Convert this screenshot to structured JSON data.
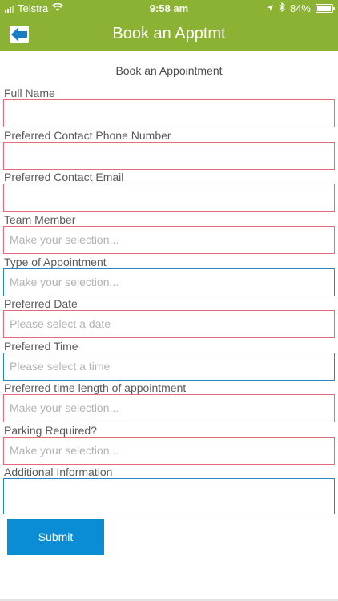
{
  "status_bar": {
    "carrier": "Telstra",
    "time": "9:58 am",
    "battery": "84%"
  },
  "header": {
    "title": "Book an Apptmt"
  },
  "form": {
    "title": "Book an Appointment",
    "fields": [
      {
        "label": "Full Name",
        "value": ""
      },
      {
        "label": "Preferred Contact Phone Number",
        "value": ""
      },
      {
        "label": "Preferred Contact Email",
        "value": ""
      },
      {
        "label": "Team Member",
        "placeholder": "Make your selection..."
      },
      {
        "label": "Type of Appointment",
        "placeholder": "Make your selection..."
      },
      {
        "label": "Preferred Date",
        "placeholder": "Please select a date"
      },
      {
        "label": "Preferred Time",
        "placeholder": "Please select a time"
      },
      {
        "label": "Preferred time length of appointment",
        "placeholder": "Make your selection..."
      },
      {
        "label": "Parking Required?",
        "placeholder": "Make your selection..."
      },
      {
        "label": "Additional Information",
        "value": ""
      }
    ],
    "submit_label": "Submit"
  },
  "colors": {
    "header": "#8bb232",
    "invalid_border": "#e76a7a",
    "valid_border": "#2b86bf",
    "submit": "#0b8dd6"
  }
}
